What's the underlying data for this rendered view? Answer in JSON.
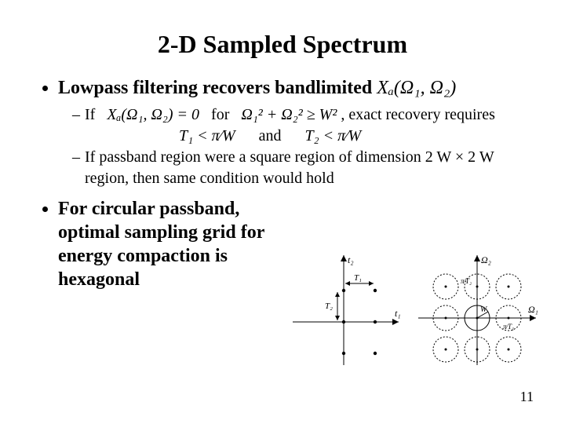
{
  "title": "2-D Sampled Spectrum",
  "bullets": {
    "b1": "Lowpass filtering recovers bandlimited",
    "b3": "For circular passband, optimal sampling grid for energy compaction is hexagonal"
  },
  "sub": {
    "if_word": "If",
    "for_word": "for",
    "exact_word": ", exact recovery requires",
    "and_word": "and",
    "s2": "If passband region were a square region of dimension 2 W × 2 W region, then same condition would hold"
  },
  "math": {
    "Xa": "Xₐ(Ω₁, Ω₂)",
    "Xa_eq0": "Xₐ(Ω₁, Ω₂) = 0",
    "circle_cond": "Ω₁² + Ω₂² ≥ W²",
    "T1": "T₁ <",
    "T2": "T₂ <",
    "piW": "π⁄W"
  },
  "fig_labels": {
    "t1": "t₁",
    "t2": "t₂",
    "T1": "T₁",
    "T2": "T₂",
    "O1": "Ω₁",
    "O2": "Ω₂",
    "W": "W",
    "piT1": "π⁄T₁",
    "piT2": "π⁄T₂"
  },
  "page_number": "11"
}
